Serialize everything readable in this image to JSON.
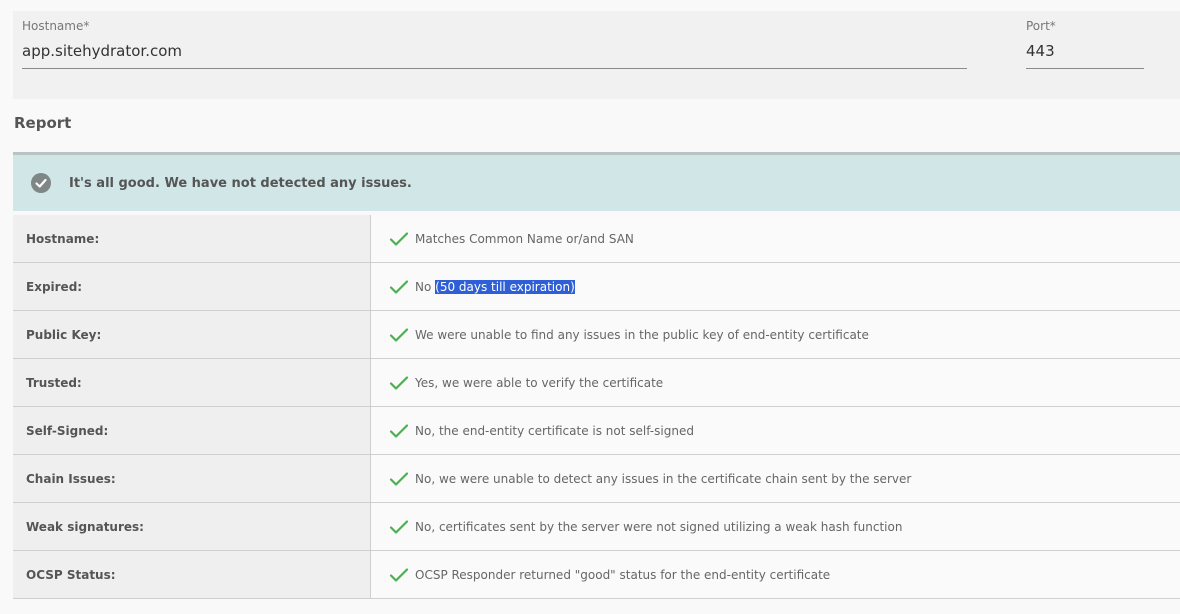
{
  "form": {
    "hostname": {
      "label": "Hostname*",
      "value": "app.sitehydrator.com"
    },
    "port": {
      "label": "Port*",
      "value": "443"
    }
  },
  "report": {
    "title": "Report",
    "banner": {
      "icon": "check-circle-icon",
      "text": "It's all good. We have not detected any issues."
    },
    "rows": [
      {
        "label": "Hostname:",
        "value": "Matches Common Name or/and SAN"
      },
      {
        "label": "Expired:",
        "value": "No",
        "highlight": "(50 days till expiration)"
      },
      {
        "label": "Public Key:",
        "value": "We were unable to find any issues in the public key of end-entity certificate"
      },
      {
        "label": "Trusted:",
        "value": "Yes, we were able to verify the certificate"
      },
      {
        "label": "Self-Signed:",
        "value": "No, the end-entity certificate is not self-signed"
      },
      {
        "label": "Chain Issues:",
        "value": "No, we were unable to detect any issues in the certificate chain sent by the server"
      },
      {
        "label": "Weak signatures:",
        "value": "No, certificates sent by the server were not signed utilizing a weak hash function"
      },
      {
        "label": "OCSP Status:",
        "value": "OCSP Responder returned \"good\" status for the end-entity certificate"
      }
    ]
  },
  "colors": {
    "check": "#4caf50",
    "highlight": "#2e5fd6",
    "banner": "#d1e6e7"
  }
}
